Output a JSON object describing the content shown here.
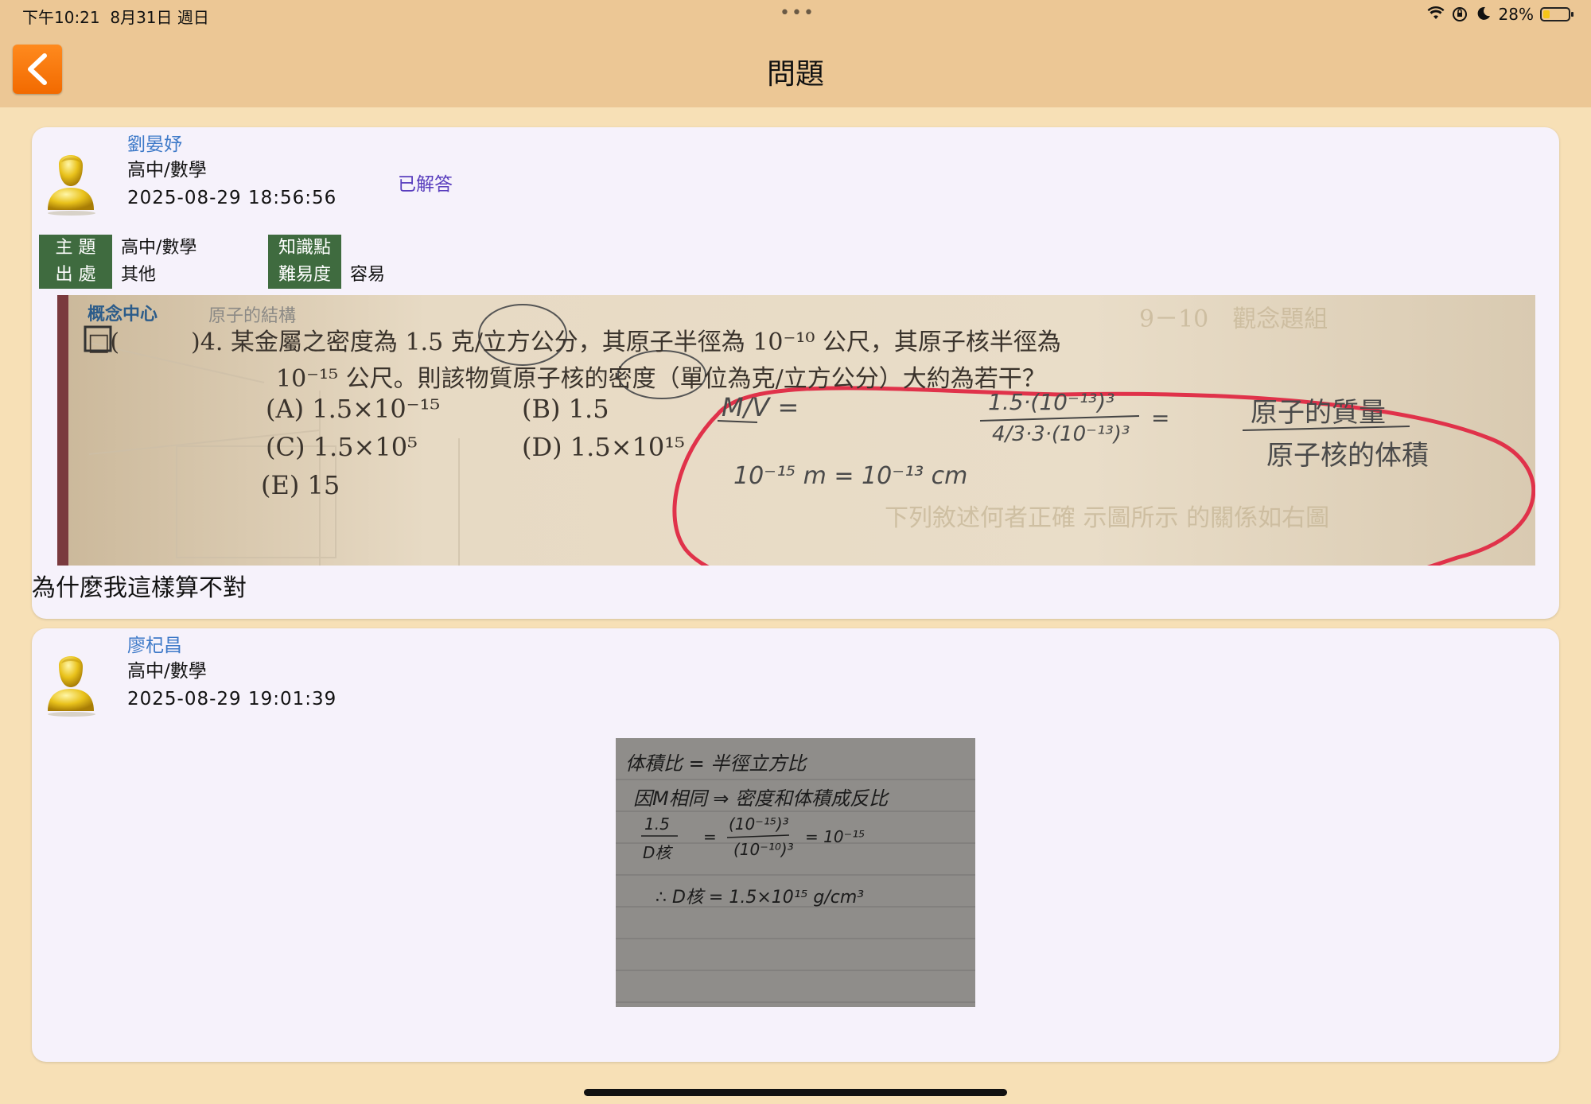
{
  "status": {
    "time": "下午10:21",
    "date": "8月31日 週日",
    "battery": "28%",
    "battery_level": 0.28
  },
  "nav": {
    "title": "問題",
    "back_icon": "chevron-left-icon",
    "accent": "#f47a0a"
  },
  "question_post": {
    "author": "劉晏妤",
    "subject": "高中/數學",
    "time": "2025-08-29 18:56:56",
    "status": "已解答",
    "meta": {
      "topic_label": "主 題",
      "topic_value": "高中/數學",
      "source_label": "出 處",
      "source_value": "其他",
      "knowledge_label": "知識點",
      "knowledge_value": "",
      "difficulty_label": "難易度",
      "difficulty_value": "容易"
    },
    "photo": {
      "header_tag": "概念中心",
      "header_topic": "原子的結構",
      "line1": "□(　　　)4. 某金屬之密度為 1.5 克/立方公分，其原子半徑為 10⁻¹⁰ 公尺，其原子核半徑為",
      "line2": "10⁻¹⁵ 公尺。則該物質原子核的密度（單位為克/立方公分）大約為若干？",
      "choice_a": "(A) 1.5×10⁻¹⁵",
      "choice_b": "(B) 1.5",
      "choice_c": "(C) 1.5×10⁵",
      "choice_d": "(D) 1.5×10¹⁵",
      "choice_e": "(E) 15",
      "hw_mv": "M/V =",
      "hw_frac_num": "1.5·(10⁻¹³)³",
      "hw_frac_den": "4/3·3·(10⁻¹³)³",
      "hw_right_num": "原子的質量",
      "hw_right_den": "原子核的体積",
      "hw_conv": "10⁻¹⁵ m = 10⁻¹³ cm"
    },
    "text": "為什麼我這樣算不對"
  },
  "answer_post": {
    "author": "廖杞昌",
    "subject": "高中/數學",
    "time": "2025-08-29 19:01:39",
    "photo": {
      "line1": "体積比 = 半徑立方比",
      "line2": "因M相同 ⇒ 密度和体積成反比",
      "eq_left_num": "1.5",
      "eq_left_den": "D核",
      "eq_mid_num": "(10⁻¹⁵)³",
      "eq_mid_den": "(10⁻¹⁰)³",
      "eq_result": "= 10⁻¹⁵",
      "conclusion": "∴ D核 = 1.5×10¹⁵ g/cm³"
    }
  }
}
